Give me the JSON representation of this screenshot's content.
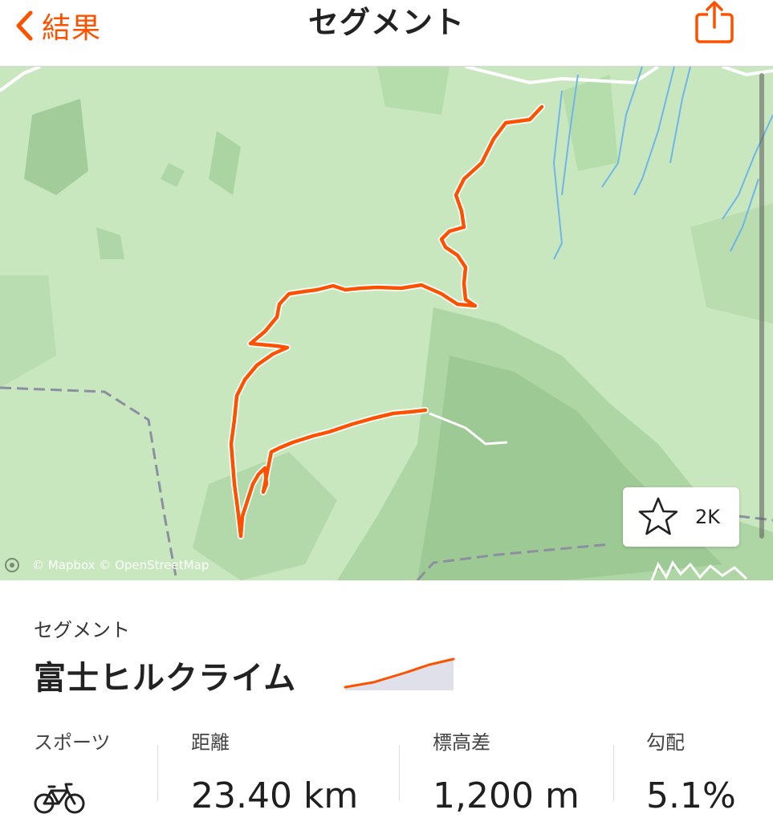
{
  "nav": {
    "back_label": "結果",
    "title": "セグメント"
  },
  "map": {
    "attribution": "© Mapbox © OpenStreetMap",
    "star_count": "2K",
    "route_color": "#fc5200"
  },
  "segment": {
    "section_label": "セグメント",
    "name": "富士ヒルクライム"
  },
  "stats": [
    {
      "label": "スポーツ",
      "icon": "bike-icon"
    },
    {
      "label": "距離",
      "value": "23.40 km"
    },
    {
      "label": "標高差",
      "value": "1,200 m"
    },
    {
      "label": "勾配",
      "value": "5.1%"
    }
  ],
  "colors": {
    "accent": "#fc5200",
    "map_base": "#c9e7bf"
  }
}
